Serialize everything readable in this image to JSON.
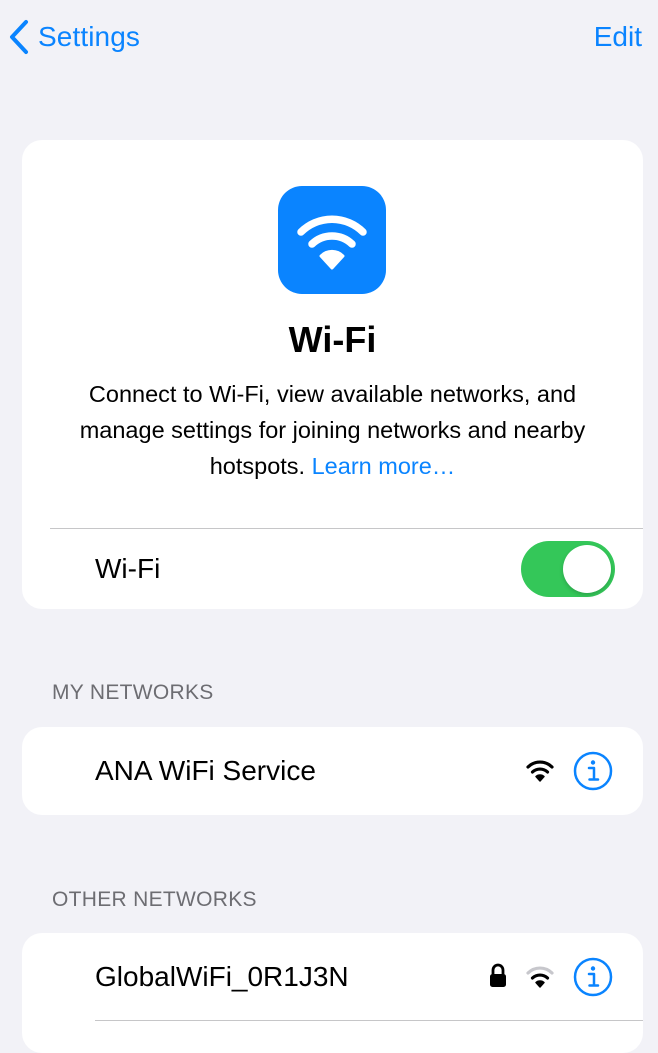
{
  "nav": {
    "back_label": "Settings",
    "edit_label": "Edit",
    "accent_color": "#0a84ff"
  },
  "hero": {
    "icon": "wifi-icon",
    "title": "Wi-Fi",
    "description": "Connect to Wi-Fi, view available networks, and manage settings for joining networks and nearby hotspots.",
    "learn_more": "Learn more…",
    "toggle_label": "Wi-Fi",
    "toggle_on": true,
    "toggle_color": "#34c759"
  },
  "my_networks": {
    "header": "MY NETWORKS",
    "items": [
      {
        "name": "ANA WiFi Service",
        "locked": false,
        "signal": "full",
        "info_icon": "info-icon"
      }
    ]
  },
  "other_networks": {
    "header": "OTHER NETWORKS",
    "items": [
      {
        "name": "GlobalWiFi_0R1J3N",
        "locked": true,
        "signal": "medium",
        "info_icon": "info-icon"
      }
    ]
  }
}
